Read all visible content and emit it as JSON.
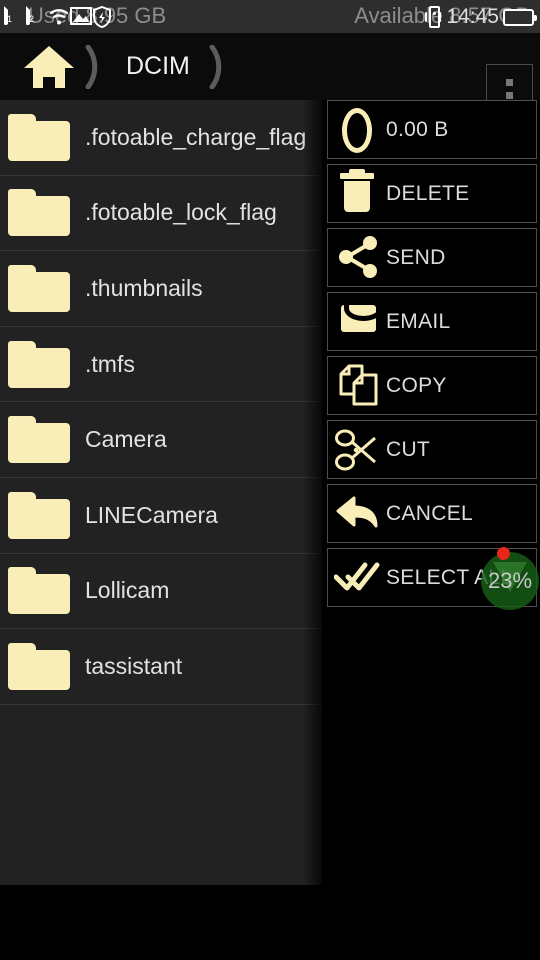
{
  "status_bar": {
    "used_text": "Used 8.95 GB",
    "available_text": "Available 8.57 GB",
    "time": "14:45",
    "icons": {
      "sim1_label": "1",
      "sim2_label": "2",
      "wifi": "wifi-icon",
      "gallery": "image-icon",
      "shield": "shield-icon",
      "vibrate": "vibrate-icon",
      "battery": "battery-icon"
    }
  },
  "toolbar": {
    "home_icon": "home-icon",
    "separator_icon": "chevron-right-icon",
    "current_folder": "DCIM",
    "overflow_icon": "overflow-menu-icon"
  },
  "file_list": {
    "items": [
      {
        "name": ".fotoable_charge_flag",
        "icon": "folder-icon"
      },
      {
        "name": ".fotoable_lock_flag",
        "icon": "folder-icon"
      },
      {
        "name": ".thumbnails",
        "icon": "folder-icon"
      },
      {
        "name": ".tmfs",
        "icon": "folder-icon"
      },
      {
        "name": "Camera",
        "icon": "folder-icon"
      },
      {
        "name": "LINECamera",
        "icon": "folder-icon"
      },
      {
        "name": "Lollicam",
        "icon": "folder-icon"
      },
      {
        "name": "tassistant",
        "icon": "folder-icon"
      }
    ]
  },
  "action_panel": {
    "items": [
      {
        "label": "0.00 B",
        "icon": "zero-icon"
      },
      {
        "label": "DELETE",
        "icon": "trash-icon"
      },
      {
        "label": "SEND",
        "icon": "share-icon"
      },
      {
        "label": "EMAIL",
        "icon": "envelope-icon"
      },
      {
        "label": "COPY",
        "icon": "copy-icon"
      },
      {
        "label": "CUT",
        "icon": "scissors-icon"
      },
      {
        "label": "CANCEL",
        "icon": "undo-arrow-icon"
      },
      {
        "label": "SELECT ALL",
        "icon": "double-check-icon"
      }
    ]
  },
  "battery_widget": {
    "percent_label": "23%",
    "circle_color": "#166016",
    "dot_color": "#e8261c"
  },
  "colors": {
    "accent_cream": "#faeeb8",
    "list_bg": "#222222",
    "panel_bg": "#000000",
    "status_bg": "#2e2e2e",
    "text": "#e2e2e2"
  }
}
